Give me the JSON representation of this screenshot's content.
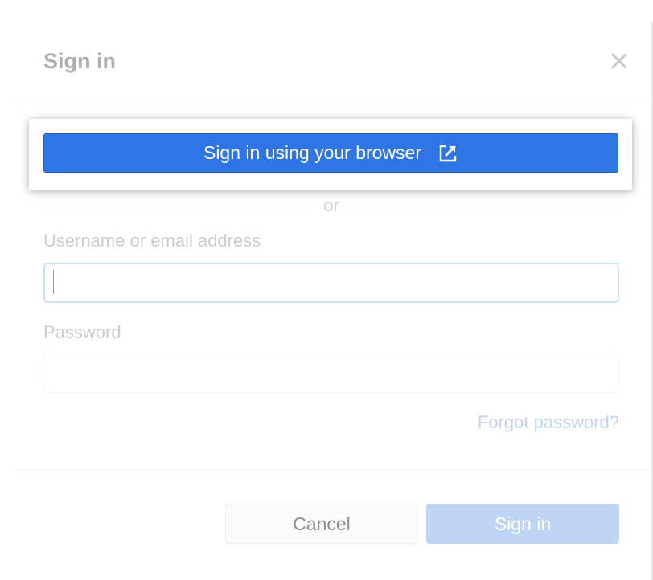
{
  "dialog": {
    "title": "Sign in",
    "close_icon": "close-icon"
  },
  "browser_signin": {
    "label": "Sign in using your browser",
    "icon": "external-link-icon"
  },
  "divider": {
    "text": "or"
  },
  "username": {
    "label": "Username or email address",
    "value": "",
    "placeholder": ""
  },
  "password": {
    "label": "Password",
    "value": "",
    "placeholder": ""
  },
  "forgot_password": {
    "label": "Forgot password?"
  },
  "footer": {
    "cancel_label": "Cancel",
    "signin_label": "Sign in"
  },
  "colors": {
    "primary": "#2f75e6",
    "primary_disabled": "#bfd3f3",
    "link": "#8fb0ea",
    "focus_border": "#a9c4ef"
  }
}
